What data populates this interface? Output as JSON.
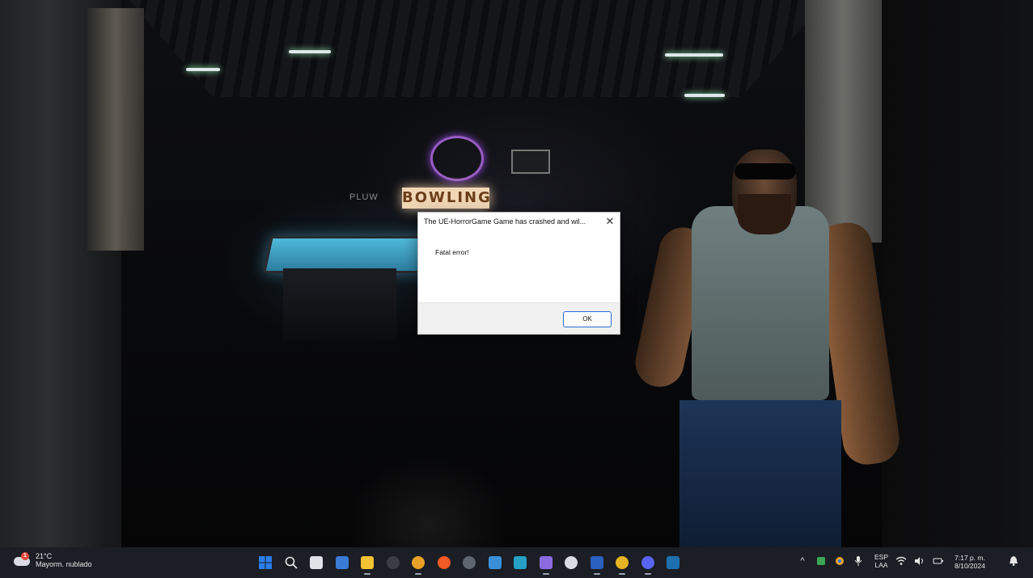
{
  "scene": {
    "sign_text": "BOWLING",
    "sign_left_text": "PLUW"
  },
  "dialog": {
    "title": "The UE-HorrorGame Game has crashed and wil...",
    "close_glyph": "✕",
    "message": "Fatal error!",
    "ok_label": "OK"
  },
  "taskbar": {
    "weather": {
      "badge": "1",
      "temperature": "21°C",
      "condition": "Mayorm. nublado"
    },
    "apps": [
      {
        "name": "start-button",
        "icon": "windows-logo-icon",
        "glyph": "",
        "color": "#2b7de9",
        "active": false
      },
      {
        "name": "search-button",
        "icon": "search-icon",
        "glyph": "",
        "color": "#1b1e24",
        "active": false
      },
      {
        "name": "task-view-button",
        "icon": "task-view-icon",
        "glyph": "",
        "color": "#dfe3e8",
        "active": false
      },
      {
        "name": "widgets-app",
        "icon": "calendar-app-icon",
        "glyph": "",
        "color": "#3a7bd5",
        "active": false
      },
      {
        "name": "file-explorer-app",
        "icon": "folder-icon",
        "glyph": "",
        "color": "#f2c232",
        "active": true
      },
      {
        "name": "obs-app",
        "icon": "obs-icon",
        "glyph": "",
        "color": "#3a3d42",
        "active": false
      },
      {
        "name": "chrome-app",
        "icon": "chrome-icon",
        "glyph": "",
        "color": "#e9a227",
        "active": true
      },
      {
        "name": "brave-app",
        "icon": "brave-icon",
        "glyph": "",
        "color": "#f05a24",
        "active": false
      },
      {
        "name": "unreal-app",
        "icon": "unreal-icon",
        "glyph": "",
        "color": "#5e6670",
        "active": false
      },
      {
        "name": "notepad-app",
        "icon": "notepad-icon",
        "glyph": "",
        "color": "#3a8fd9",
        "active": false
      },
      {
        "name": "paint-app",
        "icon": "paint-icon",
        "glyph": "",
        "color": "#26a0c4",
        "active": false
      },
      {
        "name": "capture-app",
        "icon": "capture-icon",
        "glyph": "",
        "color": "#8c6be0",
        "active": true
      },
      {
        "name": "epic-app",
        "icon": "epic-games-icon",
        "glyph": "",
        "color": "#d9dde3",
        "active": false
      },
      {
        "name": "word-app",
        "icon": "word-icon",
        "glyph": "",
        "color": "#2b5fc0",
        "active": true
      },
      {
        "name": "game-app",
        "icon": "game-character-icon",
        "glyph": "",
        "color": "#e6b422",
        "active": true
      },
      {
        "name": "discord-app",
        "icon": "discord-icon",
        "glyph": "",
        "color": "#5865f2",
        "active": true
      },
      {
        "name": "steam-app",
        "icon": "steam-icon",
        "glyph": "",
        "color": "#1e6fb0",
        "active": false
      }
    ],
    "tray": {
      "chevron": "^",
      "language_line1": "ESP",
      "language_line2": "LAA",
      "time": "7:17 p. m.",
      "date": "8/10/2024"
    }
  }
}
